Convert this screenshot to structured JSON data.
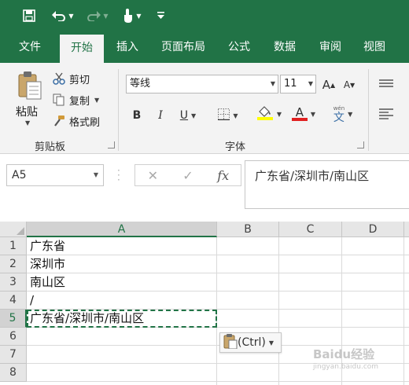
{
  "quick_access": {
    "save_icon": "save-icon",
    "undo_icon": "undo-icon",
    "redo_icon": "redo-icon",
    "touch_icon": "touch-mode-icon",
    "customize_icon": "customize-qat-icon"
  },
  "tabs": [
    {
      "label": "文件"
    },
    {
      "label": "开始"
    },
    {
      "label": "插入"
    },
    {
      "label": "页面布局"
    },
    {
      "label": "公式"
    },
    {
      "label": "数据"
    },
    {
      "label": "审阅"
    },
    {
      "label": "视图"
    }
  ],
  "ribbon": {
    "clipboard": {
      "paste_label": "粘贴",
      "cut_label": "剪切",
      "copy_label": "复制",
      "format_painter_label": "格式刷",
      "group_label": "剪贴板"
    },
    "font": {
      "font_name": "等线",
      "font_size": "11",
      "grow_label": "A",
      "shrink_label": "A",
      "bold_label": "B",
      "italic_label": "I",
      "underline_label": "U",
      "font_color_label": "A",
      "phonetic_label": "文",
      "group_label": "字体"
    }
  },
  "formula_bar": {
    "name_box": "A5",
    "fx_label": "fx",
    "value": "广东省/深圳市/南山区"
  },
  "grid": {
    "columns": [
      "A",
      "B",
      "C",
      "D"
    ],
    "rows": [
      "1",
      "2",
      "3",
      "4",
      "5",
      "6",
      "7",
      "8"
    ],
    "cells": {
      "A1": "广东省",
      "A2": "深圳市",
      "A3": "南山区",
      "A4": "/",
      "A5": "广东省/深圳市/南山区"
    }
  },
  "paste_options": {
    "label": "(Ctrl)"
  },
  "watermark": {
    "text": "Baidu经验",
    "sub": "jingyan.baidu.com"
  },
  "colors": {
    "accent": "#217346",
    "highlight": "#ffff00",
    "font_red": "#e02020"
  }
}
